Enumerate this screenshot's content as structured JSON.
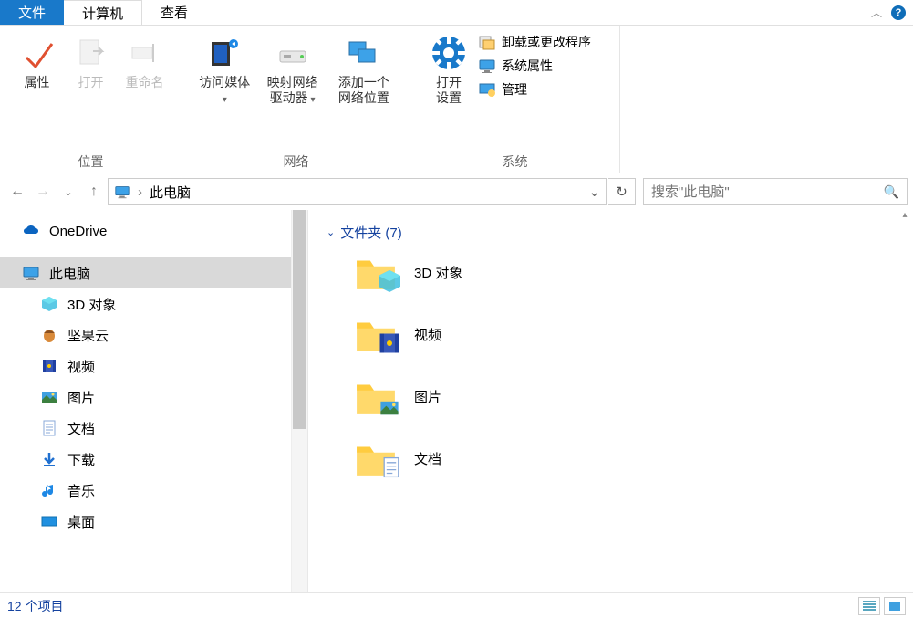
{
  "menu": {
    "file": "文件",
    "computer": "计算机",
    "view": "查看"
  },
  "ribbon": {
    "group_location": "位置",
    "group_network": "网络",
    "group_system": "系统",
    "properties": "属性",
    "open": "打开",
    "rename": "重命名",
    "access_media": "访问媒体",
    "map_drive1": "映射网络",
    "map_drive2": "驱动器",
    "add_net1": "添加一个",
    "add_net2": "网络位置",
    "open_settings1": "打开",
    "open_settings2": "设置",
    "uninstall": "卸载或更改程序",
    "sysprops": "系统属性",
    "manage": "管理"
  },
  "nav": {
    "location": "此电脑",
    "search_placeholder": "搜索\"此电脑\""
  },
  "sidebar": {
    "items": [
      {
        "label": "OneDrive",
        "level": 1,
        "icon": "onedrive"
      },
      {
        "label": "此电脑",
        "level": 1,
        "icon": "thispc",
        "selected": true
      },
      {
        "label": "3D 对象",
        "level": 2,
        "icon": "3d"
      },
      {
        "label": "坚果云",
        "level": 2,
        "icon": "nut"
      },
      {
        "label": "视频",
        "level": 2,
        "icon": "video"
      },
      {
        "label": "图片",
        "level": 2,
        "icon": "pictures"
      },
      {
        "label": "文档",
        "level": 2,
        "icon": "docs"
      },
      {
        "label": "下载",
        "level": 2,
        "icon": "download"
      },
      {
        "label": "音乐",
        "level": 2,
        "icon": "music"
      },
      {
        "label": "桌面",
        "level": 2,
        "icon": "desktop"
      }
    ]
  },
  "main": {
    "group_label": "文件夹 (7)",
    "folders": [
      {
        "label": "3D 对象",
        "icon": "3d"
      },
      {
        "label": "视频",
        "icon": "video"
      },
      {
        "label": "图片",
        "icon": "pictures"
      },
      {
        "label": "文档",
        "icon": "docs"
      }
    ]
  },
  "status": {
    "items": "12 个项目"
  }
}
